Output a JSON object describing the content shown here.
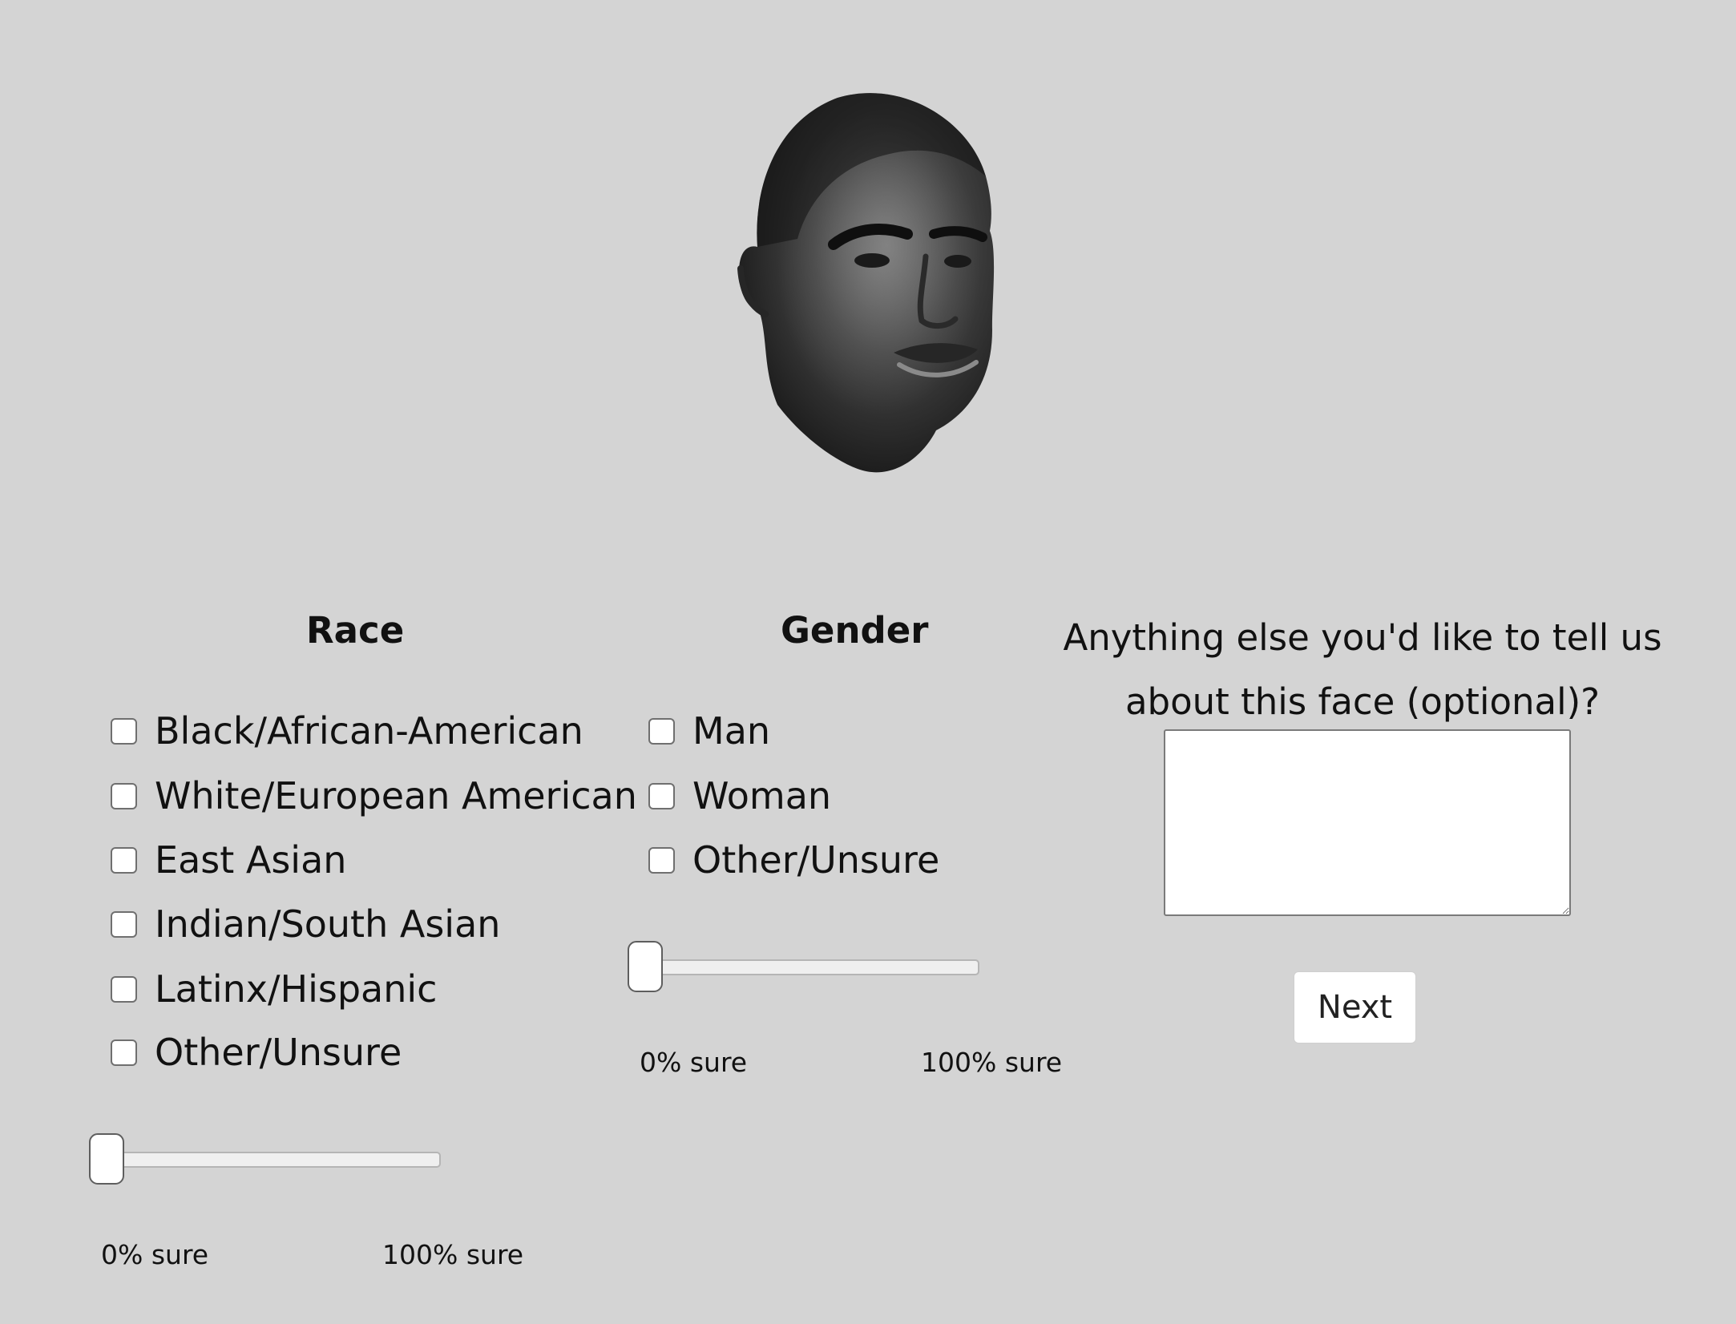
{
  "stimulus": {
    "image_description": "grayscale 3D face model"
  },
  "race": {
    "title": "Race",
    "options": [
      "Black/African-American",
      "White/European American",
      "East Asian",
      "Indian/South Asian",
      "Latinx/Hispanic",
      "Other/Unsure"
    ],
    "slider": {
      "value": 0,
      "min_label": "0% sure",
      "max_label": "100% sure"
    }
  },
  "gender": {
    "title": "Gender",
    "options": [
      "Man",
      "Woman",
      "Other/Unsure"
    ],
    "slider": {
      "value": 0,
      "min_label": "0% sure",
      "max_label": "100% sure"
    }
  },
  "comments": {
    "question": "Anything else you'd like to tell us about this face (optional)?",
    "value": ""
  },
  "next_label": "Next"
}
